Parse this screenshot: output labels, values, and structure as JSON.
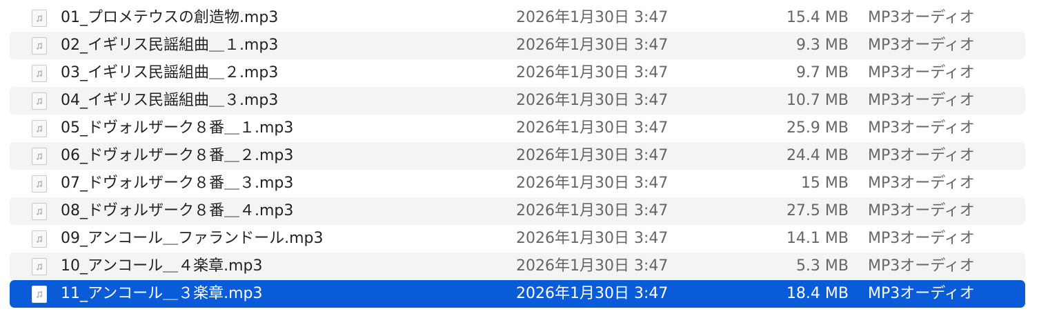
{
  "files": [
    {
      "name": "01_プロメテウスの創造物.mp3",
      "date": "2026年1月30日 3:47",
      "size": "15.4 MB",
      "kind": "MP3オーディオ",
      "selected": false
    },
    {
      "name": "02_イギリス民謡組曲＿１.mp3",
      "date": "2026年1月30日 3:47",
      "size": "9.3 MB",
      "kind": "MP3オーディオ",
      "selected": false
    },
    {
      "name": "03_イギリス民謡組曲＿２.mp3",
      "date": "2026年1月30日 3:47",
      "size": "9.7 MB",
      "kind": "MP3オーディオ",
      "selected": false
    },
    {
      "name": "04_イギリス民謡組曲＿３.mp3",
      "date": "2026年1月30日 3:47",
      "size": "10.7 MB",
      "kind": "MP3オーディオ",
      "selected": false
    },
    {
      "name": "05_ドヴォルザーク８番＿１.mp3",
      "date": "2026年1月30日 3:47",
      "size": "25.9 MB",
      "kind": "MP3オーディオ",
      "selected": false
    },
    {
      "name": "06_ドヴォルザーク８番＿２.mp3",
      "date": "2026年1月30日 3:47",
      "size": "24.4 MB",
      "kind": "MP3オーディオ",
      "selected": false
    },
    {
      "name": "07_ドヴォルザーク８番＿３.mp3",
      "date": "2026年1月30日 3:47",
      "size": "15 MB",
      "kind": "MP3オーディオ",
      "selected": false
    },
    {
      "name": "08_ドヴォルザーク８番＿４.mp3",
      "date": "2026年1月30日 3:47",
      "size": "27.5 MB",
      "kind": "MP3オーディオ",
      "selected": false
    },
    {
      "name": "09_アンコール＿ファランドール.mp3",
      "date": "2026年1月30日 3:47",
      "size": "14.1 MB",
      "kind": "MP3オーディオ",
      "selected": false
    },
    {
      "name": "10_アンコール＿４楽章.mp3",
      "date": "2026年1月30日 3:47",
      "size": "5.3 MB",
      "kind": "MP3オーディオ",
      "selected": false
    },
    {
      "name": "11_アンコール＿３楽章.mp3",
      "date": "2026年1月30日 3:47",
      "size": "18.4 MB",
      "kind": "MP3オーディオ",
      "selected": true
    }
  ],
  "icons": {
    "file": "audio-file-icon"
  },
  "colors": {
    "selection": "#0a5bd8",
    "stripe": "#f4f4f5",
    "secondary_text": "#666666"
  }
}
